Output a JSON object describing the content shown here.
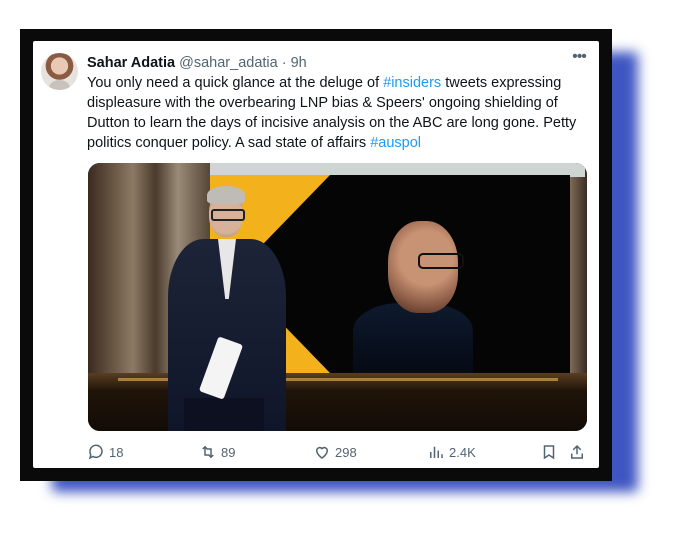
{
  "tweet": {
    "author_name": "Sahar Adatia",
    "handle": "@sahar_adatia",
    "separator": "·",
    "time": "9h",
    "more_icon": "more-icon",
    "text": {
      "part1": "You only need a quick glance at the deluge of ",
      "hashtag1": "#insiders",
      "part2": " tweets expressing displeasure with the overbearing LNP bias & Speers' ongoing shielding of Dutton to learn the days of incisive analysis on the ABC are long gone. Petty politics conquer policy. A sad state of affairs ",
      "hashtag2": "#auspol"
    },
    "actions": {
      "replies": "18",
      "retweets": "89",
      "likes": "298",
      "views": "2.4K"
    }
  },
  "colors": {
    "hashtag": "#1d9bf0",
    "muted": "#536471",
    "frame": "#0a0a0a",
    "shadow": "#3f56c2"
  }
}
